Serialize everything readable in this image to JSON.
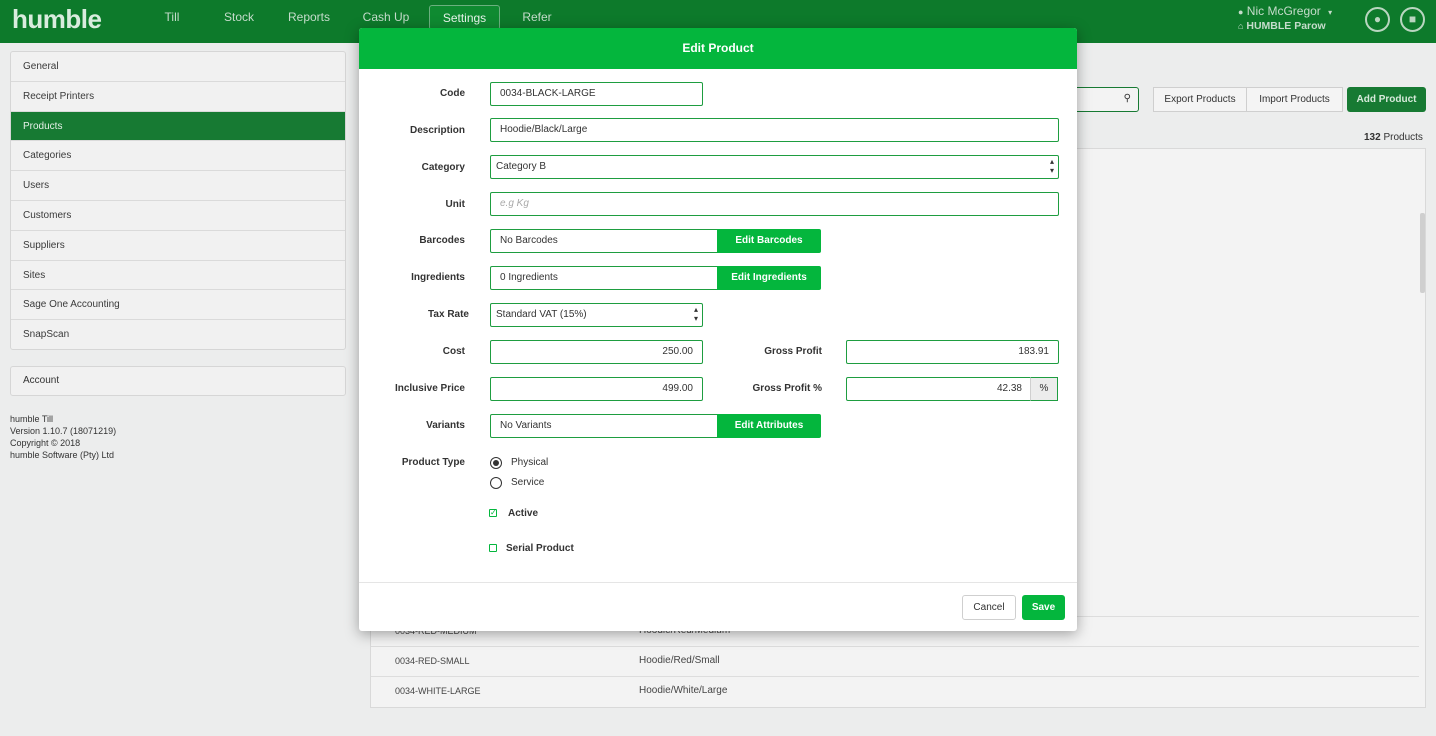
{
  "app": {
    "logo": "humble",
    "nav": [
      "Till",
      "Stock",
      "Reports",
      "Cash Up",
      "Settings",
      "Refer"
    ],
    "active_nav": "Settings",
    "user_name": "Nic McGregor",
    "user_caret": "▾",
    "site": "HUMBLE Parow",
    "site_icon": "home-icon",
    "chat_icon": "chat-icon",
    "lock_icon": "lock-icon"
  },
  "sidebar": {
    "items": [
      "General",
      "Receipt Printers",
      "Products",
      "Categories",
      "Users",
      "Customers",
      "Suppliers",
      "Sites",
      "Sage One Accounting",
      "SnapScan"
    ],
    "active": "Products",
    "account": "Account"
  },
  "about": {
    "app": "humble Till",
    "version": "Version 1.10.7 (18071219)",
    "copyright": "Copyright © 2018",
    "company": "humble Software (Pty) Ltd"
  },
  "products_page": {
    "export_label": "Export Products",
    "import_label": "Import Products",
    "add_label": "Add Product",
    "search_icon": "search-icon",
    "count_number": "132",
    "count_label": "Products",
    "rows": [
      {
        "code": "0034-RED-MEDIUM",
        "description": "Hoodie/Red/Medium"
      },
      {
        "code": "0034-RED-SMALL",
        "description": "Hoodie/Red/Small"
      },
      {
        "code": "0034-WHITE-LARGE",
        "description": "Hoodie/White/Large"
      }
    ]
  },
  "modal": {
    "title": "Edit Product",
    "labels": {
      "code": "Code",
      "description": "Description",
      "category": "Category",
      "unit": "Unit",
      "barcodes": "Barcodes",
      "ingredients": "Ingredients",
      "tax_rate": "Tax Rate",
      "cost": "Cost",
      "gross_profit": "Gross Profit",
      "inclusive_price": "Inclusive Price",
      "gross_profit_pct": "Gross Profit %",
      "variants": "Variants",
      "product_type": "Product Type"
    },
    "values": {
      "code": "0034-BLACK-LARGE",
      "description": "Hoodie/Black/Large",
      "category": "Category B",
      "unit_placeholder": "e.g Kg",
      "barcodes": "No Barcodes",
      "ingredients": "0 Ingredients",
      "tax_rate": "Standard VAT (15%)",
      "cost": "250.00",
      "gross_profit": "183.91",
      "inclusive_price": "499.00",
      "gross_profit_pct": "42.38",
      "pct_addon": "%",
      "variants": "No Variants"
    },
    "buttons": {
      "edit_barcodes": "Edit Barcodes",
      "edit_ingredients": "Edit Ingredients",
      "edit_attributes": "Edit Attributes",
      "cancel": "Cancel",
      "save": "Save"
    },
    "product_type_options": [
      "Physical",
      "Service"
    ],
    "product_type_selected": "Physical",
    "active_label": "Active",
    "active_checked": true,
    "serial_label": "Serial Product",
    "serial_checked": false,
    "select_arrows": "▴▾"
  }
}
